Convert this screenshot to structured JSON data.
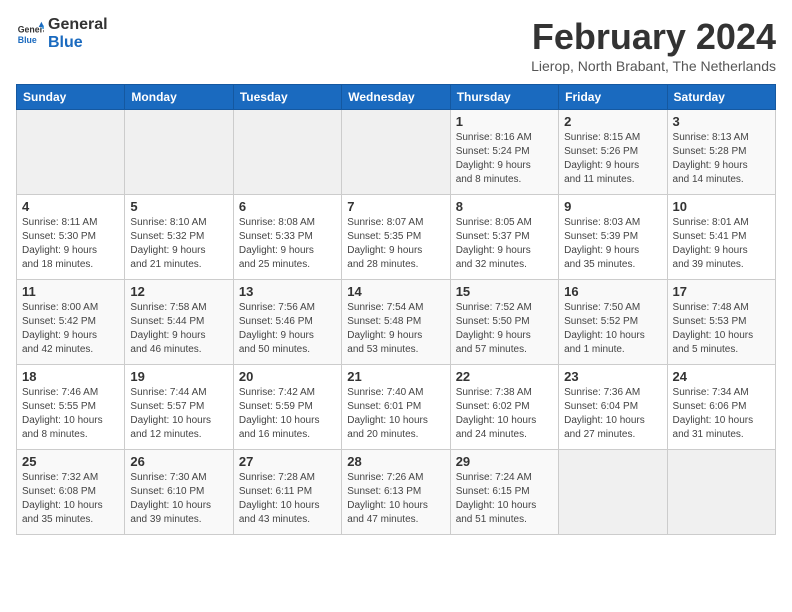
{
  "logo": {
    "line1": "General",
    "line2": "Blue"
  },
  "header": {
    "month_year": "February 2024",
    "location": "Lierop, North Brabant, The Netherlands"
  },
  "weekdays": [
    "Sunday",
    "Monday",
    "Tuesday",
    "Wednesday",
    "Thursday",
    "Friday",
    "Saturday"
  ],
  "weeks": [
    [
      {
        "day": "",
        "info": ""
      },
      {
        "day": "",
        "info": ""
      },
      {
        "day": "",
        "info": ""
      },
      {
        "day": "",
        "info": ""
      },
      {
        "day": "1",
        "info": "Sunrise: 8:16 AM\nSunset: 5:24 PM\nDaylight: 9 hours\nand 8 minutes."
      },
      {
        "day": "2",
        "info": "Sunrise: 8:15 AM\nSunset: 5:26 PM\nDaylight: 9 hours\nand 11 minutes."
      },
      {
        "day": "3",
        "info": "Sunrise: 8:13 AM\nSunset: 5:28 PM\nDaylight: 9 hours\nand 14 minutes."
      }
    ],
    [
      {
        "day": "4",
        "info": "Sunrise: 8:11 AM\nSunset: 5:30 PM\nDaylight: 9 hours\nand 18 minutes."
      },
      {
        "day": "5",
        "info": "Sunrise: 8:10 AM\nSunset: 5:32 PM\nDaylight: 9 hours\nand 21 minutes."
      },
      {
        "day": "6",
        "info": "Sunrise: 8:08 AM\nSunset: 5:33 PM\nDaylight: 9 hours\nand 25 minutes."
      },
      {
        "day": "7",
        "info": "Sunrise: 8:07 AM\nSunset: 5:35 PM\nDaylight: 9 hours\nand 28 minutes."
      },
      {
        "day": "8",
        "info": "Sunrise: 8:05 AM\nSunset: 5:37 PM\nDaylight: 9 hours\nand 32 minutes."
      },
      {
        "day": "9",
        "info": "Sunrise: 8:03 AM\nSunset: 5:39 PM\nDaylight: 9 hours\nand 35 minutes."
      },
      {
        "day": "10",
        "info": "Sunrise: 8:01 AM\nSunset: 5:41 PM\nDaylight: 9 hours\nand 39 minutes."
      }
    ],
    [
      {
        "day": "11",
        "info": "Sunrise: 8:00 AM\nSunset: 5:42 PM\nDaylight: 9 hours\nand 42 minutes."
      },
      {
        "day": "12",
        "info": "Sunrise: 7:58 AM\nSunset: 5:44 PM\nDaylight: 9 hours\nand 46 minutes."
      },
      {
        "day": "13",
        "info": "Sunrise: 7:56 AM\nSunset: 5:46 PM\nDaylight: 9 hours\nand 50 minutes."
      },
      {
        "day": "14",
        "info": "Sunrise: 7:54 AM\nSunset: 5:48 PM\nDaylight: 9 hours\nand 53 minutes."
      },
      {
        "day": "15",
        "info": "Sunrise: 7:52 AM\nSunset: 5:50 PM\nDaylight: 9 hours\nand 57 minutes."
      },
      {
        "day": "16",
        "info": "Sunrise: 7:50 AM\nSunset: 5:52 PM\nDaylight: 10 hours\nand 1 minute."
      },
      {
        "day": "17",
        "info": "Sunrise: 7:48 AM\nSunset: 5:53 PM\nDaylight: 10 hours\nand 5 minutes."
      }
    ],
    [
      {
        "day": "18",
        "info": "Sunrise: 7:46 AM\nSunset: 5:55 PM\nDaylight: 10 hours\nand 8 minutes."
      },
      {
        "day": "19",
        "info": "Sunrise: 7:44 AM\nSunset: 5:57 PM\nDaylight: 10 hours\nand 12 minutes."
      },
      {
        "day": "20",
        "info": "Sunrise: 7:42 AM\nSunset: 5:59 PM\nDaylight: 10 hours\nand 16 minutes."
      },
      {
        "day": "21",
        "info": "Sunrise: 7:40 AM\nSunset: 6:01 PM\nDaylight: 10 hours\nand 20 minutes."
      },
      {
        "day": "22",
        "info": "Sunrise: 7:38 AM\nSunset: 6:02 PM\nDaylight: 10 hours\nand 24 minutes."
      },
      {
        "day": "23",
        "info": "Sunrise: 7:36 AM\nSunset: 6:04 PM\nDaylight: 10 hours\nand 27 minutes."
      },
      {
        "day": "24",
        "info": "Sunrise: 7:34 AM\nSunset: 6:06 PM\nDaylight: 10 hours\nand 31 minutes."
      }
    ],
    [
      {
        "day": "25",
        "info": "Sunrise: 7:32 AM\nSunset: 6:08 PM\nDaylight: 10 hours\nand 35 minutes."
      },
      {
        "day": "26",
        "info": "Sunrise: 7:30 AM\nSunset: 6:10 PM\nDaylight: 10 hours\nand 39 minutes."
      },
      {
        "day": "27",
        "info": "Sunrise: 7:28 AM\nSunset: 6:11 PM\nDaylight: 10 hours\nand 43 minutes."
      },
      {
        "day": "28",
        "info": "Sunrise: 7:26 AM\nSunset: 6:13 PM\nDaylight: 10 hours\nand 47 minutes."
      },
      {
        "day": "29",
        "info": "Sunrise: 7:24 AM\nSunset: 6:15 PM\nDaylight: 10 hours\nand 51 minutes."
      },
      {
        "day": "",
        "info": ""
      },
      {
        "day": "",
        "info": ""
      }
    ]
  ]
}
